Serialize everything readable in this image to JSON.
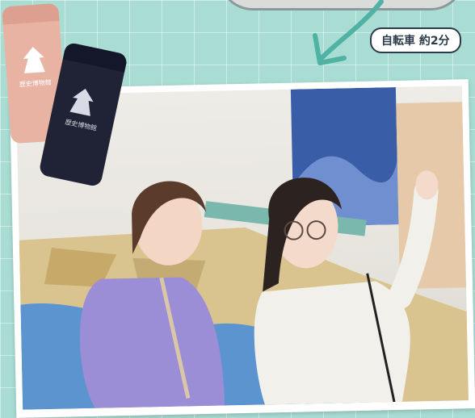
{
  "badge": {
    "text": "自転車 約2分"
  },
  "bottles": [
    {
      "name": "pink-tumbler",
      "label": "歴史博物館",
      "color": "#e9b3a3"
    },
    {
      "name": "navy-tumbler",
      "label": "歴史博物館",
      "color": "#1f2335"
    }
  ],
  "colors": {
    "background": "#a9ddd3",
    "arrow": "#4fb2a3",
    "badge_border": "#2a3b4a",
    "sweater": "#9b8dd6",
    "blouse": "#f2f0ea"
  }
}
